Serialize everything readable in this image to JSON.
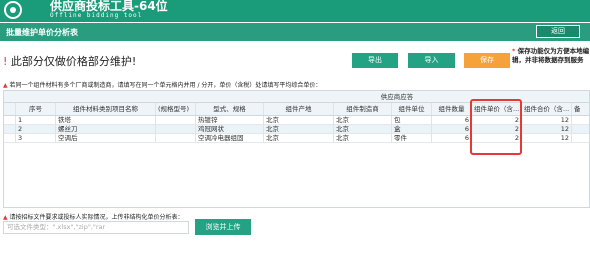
{
  "app": {
    "title": "供应商投标工具-64位",
    "subtitle": "Offline bidding tool"
  },
  "subbar": {
    "title": "批量维护单价分析表",
    "return_label": "返回"
  },
  "headline": {
    "mark": "!",
    "text": "此部分仅做价格部分维护!"
  },
  "toolbar": {
    "export_label": "导出",
    "import_label": "导入",
    "save_label": "保存"
  },
  "side_note": {
    "star": "*",
    "text": "保存功能仅为方便本地编辑，并非将数据存到服务"
  },
  "warning": "若同一个组件材料有多个厂商或制造商，请填写在同一个单元格内并用 / 分开，单价（含税）处请填写平均综合单价：",
  "table": {
    "group_header": "供应商应答",
    "columns": [
      "序号",
      "组件材料类别项目名称",
      "(规格型号)",
      "型式、规格",
      "组件产地",
      "组件制造商",
      "组件单位",
      "组件数量",
      "组件单价（含...",
      "组件合价（含...",
      "备"
    ],
    "rows": [
      {
        "no": "1",
        "name": "铁塔",
        "spec_model": "",
        "type_spec": "热镀锌",
        "origin": "北京",
        "maker": "北京",
        "unit": "包",
        "qty": "6",
        "unit_price": "2",
        "total": "12"
      },
      {
        "no": "2",
        "name": "螺丝刀",
        "spec_model": "",
        "type_spec": "鸡冠网状",
        "origin": "北京",
        "maker": "北京",
        "unit": "盒",
        "qty": "6",
        "unit_price": "2",
        "total": "12"
      },
      {
        "no": "3",
        "name": "空调后",
        "spec_model": "",
        "type_spec": "空调冷电器组固",
        "origin": "北京",
        "maker": "北京",
        "unit": "零件",
        "qty": "6",
        "unit_price": "2",
        "total": "12"
      }
    ]
  },
  "upload": {
    "note": "请按招标文件要求或投标人实际情况，上传非结构化单价分析表：",
    "placeholder": "可选文件类型：\".xlsx\",\"zip\",\"rar",
    "button_label": "浏览并上传"
  }
}
